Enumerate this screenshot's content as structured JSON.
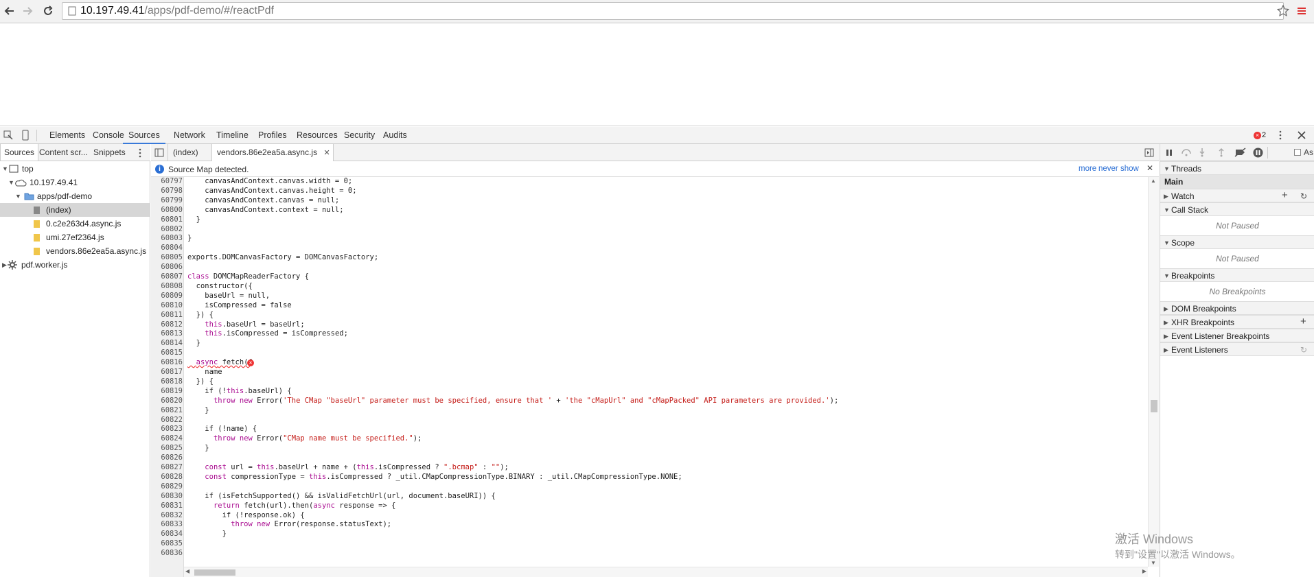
{
  "browser": {
    "url_host": "10.197.49.41",
    "url_path": "/apps/pdf-demo/#/reactPdf"
  },
  "devtools": {
    "tabs": [
      "Elements",
      "Console",
      "Sources",
      "Network",
      "Timeline",
      "Profiles",
      "Resources",
      "Security",
      "Audits"
    ],
    "active_tab": "Sources",
    "error_count": "2"
  },
  "navigator": {
    "tabs": [
      "Sources",
      "Content scr...",
      "Snippets"
    ],
    "tree": [
      "top",
      "10.197.49.41",
      "apps/pdf-demo",
      "(index)",
      "0.c2e263d4.async.js",
      "umi.27ef2364.js",
      "vendors.86e2ea5a.async.js",
      "pdf.worker.js"
    ]
  },
  "editor": {
    "tabs": [
      "(index)",
      "vendors.86e2ea5a.async.js"
    ],
    "sourcemap_msg": "Source Map detected.",
    "sourcemap_more": "more",
    "sourcemap_never": "never show",
    "lines": [
      {
        "n": "60797",
        "t": "    canvasAndContext.canvas.width = 0;"
      },
      {
        "n": "60798",
        "t": "    canvasAndContext.canvas.height = 0;"
      },
      {
        "n": "60799",
        "t": "    canvasAndContext.canvas = null;"
      },
      {
        "n": "60800",
        "t": "    canvasAndContext.context = null;"
      },
      {
        "n": "60801",
        "t": "  }"
      },
      {
        "n": "60802",
        "t": ""
      },
      {
        "n": "60803",
        "t": "}"
      },
      {
        "n": "60804",
        "t": ""
      },
      {
        "n": "60805",
        "t": "exports.DOMCanvasFactory = DOMCanvasFactory;"
      },
      {
        "n": "60806",
        "t": ""
      },
      {
        "n": "60807",
        "t": "class DOMCMapReaderFactory {"
      },
      {
        "n": "60808",
        "t": "  constructor({"
      },
      {
        "n": "60809",
        "t": "    baseUrl = null,"
      },
      {
        "n": "60810",
        "t": "    isCompressed = false"
      },
      {
        "n": "60811",
        "t": "  }) {"
      },
      {
        "n": "60812",
        "t": "    this.baseUrl = baseUrl;"
      },
      {
        "n": "60813",
        "t": "    this.isCompressed = isCompressed;"
      },
      {
        "n": "60814",
        "t": "  }"
      },
      {
        "n": "60815",
        "t": ""
      },
      {
        "n": "60816",
        "t": "  async fetch({"
      },
      {
        "n": "60817",
        "t": "    name"
      },
      {
        "n": "60818",
        "t": "  }) {"
      },
      {
        "n": "60819",
        "t": "    if (!this.baseUrl) {"
      },
      {
        "n": "60820",
        "t": "      throw new Error('The CMap \"baseUrl\" parameter must be specified, ensure that ' + 'the \"cMapUrl\" and \"cMapPacked\" API parameters are provided.');"
      },
      {
        "n": "60821",
        "t": "    }"
      },
      {
        "n": "60822",
        "t": ""
      },
      {
        "n": "60823",
        "t": "    if (!name) {"
      },
      {
        "n": "60824",
        "t": "      throw new Error(\"CMap name must be specified.\");"
      },
      {
        "n": "60825",
        "t": "    }"
      },
      {
        "n": "60826",
        "t": ""
      },
      {
        "n": "60827",
        "t": "    const url = this.baseUrl + name + (this.isCompressed ? \".bcmap\" : \"\");"
      },
      {
        "n": "60828",
        "t": "    const compressionType = this.isCompressed ? _util.CMapCompressionType.BINARY : _util.CMapCompressionType.NONE;"
      },
      {
        "n": "60829",
        "t": ""
      },
      {
        "n": "60830",
        "t": "    if (isFetchSupported() && isValidFetchUrl(url, document.baseURI)) {"
      },
      {
        "n": "60831",
        "t": "      return fetch(url).then(async response => {"
      },
      {
        "n": "60832",
        "t": "        if (!response.ok) {"
      },
      {
        "n": "60833",
        "t": "          throw new Error(response.statusText);"
      },
      {
        "n": "60834",
        "t": "        }"
      },
      {
        "n": "60835",
        "t": ""
      },
      {
        "n": "60836",
        "t": ""
      }
    ]
  },
  "debugger": {
    "async_label": "As",
    "threads": "Threads",
    "main": "Main",
    "watch": "Watch",
    "call_stack": "Call Stack",
    "not_paused_1": "Not Paused",
    "scope": "Scope",
    "not_paused_2": "Not Paused",
    "breakpoints": "Breakpoints",
    "no_breakpoints": "No Breakpoints",
    "dom_breakpoints": "DOM Breakpoints",
    "xhr_breakpoints": "XHR Breakpoints",
    "event_listener_breakpoints": "Event Listener Breakpoints",
    "event_listeners": "Event Listeners"
  },
  "watermark": {
    "line1": "激活 Windows",
    "line2": "转到\"设置\"以激活 Windows。"
  }
}
